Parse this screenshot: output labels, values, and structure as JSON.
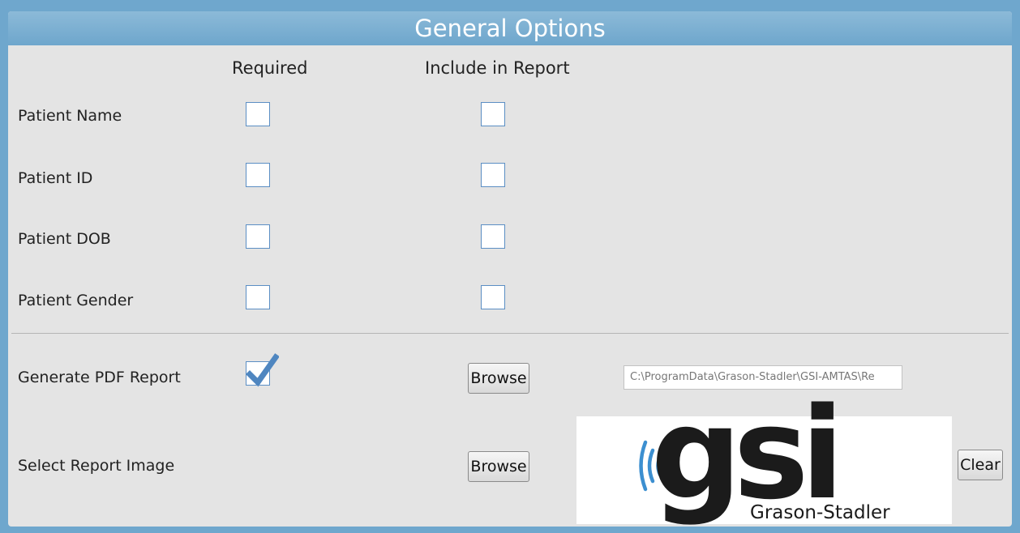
{
  "header": {
    "title": "General Options"
  },
  "columns": {
    "required": "Required",
    "include": "Include in Report"
  },
  "patient_rows": [
    {
      "label": "Patient Name",
      "required": false,
      "include": false
    },
    {
      "label": "Patient ID",
      "required": false,
      "include": false
    },
    {
      "label": "Patient DOB",
      "required": false,
      "include": false
    },
    {
      "label": "Patient Gender",
      "required": false,
      "include": false
    }
  ],
  "pdf": {
    "label": "Generate PDF Report",
    "checked": true,
    "browse_label": "Browse",
    "path": "C:\\ProgramData\\Grason-Stadler\\GSI-AMTAS\\Re"
  },
  "report_image": {
    "label": "Select Report Image",
    "browse_label": "Browse",
    "clear_label": "Clear",
    "logo_text": "gsi",
    "logo_subtext": "Grason-Stadler"
  },
  "colors": {
    "header_bg": "#6ea6cc",
    "panel_bg": "#e4e4e4",
    "checkbox_border": "#5b8ec4",
    "checkmark": "#4f86c0",
    "logo_wave": "#3c8fd0"
  }
}
